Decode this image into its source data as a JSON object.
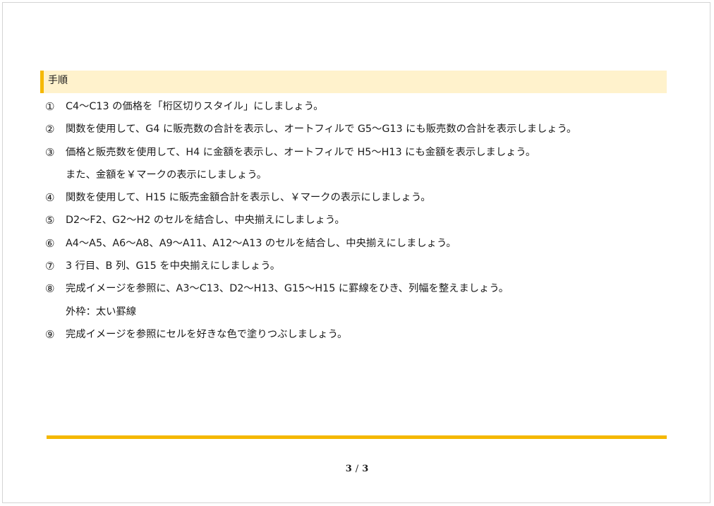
{
  "section": {
    "title": "手順"
  },
  "steps": [
    {
      "num": "①",
      "text": "C4～C13 の価格を「桁区切りスタイル」にしましょう。"
    },
    {
      "num": "②",
      "text": "関数を使用して、G4 に販売数の合計を表示し、オートフィルで G5～G13 にも販売数の合計を表示しましょう。"
    },
    {
      "num": "③",
      "text": "価格と販売数を使用して、H4 に金額を表示し、オートフィルで H5～H13 にも金額を表示しましょう。"
    },
    {
      "num": "",
      "text": "また、金額を￥マークの表示にしましょう。"
    },
    {
      "num": "④",
      "text": "関数を使用して、H15 に販売金額合計を表示し、￥マークの表示にしましょう。"
    },
    {
      "num": "⑤",
      "text": "D2～F2、G2～H2 のセルを結合し、中央揃えにしましょう。"
    },
    {
      "num": "⑥",
      "text": "A4～A5、A6～A8、A9～A11、A12～A13 のセルを結合し、中央揃えにしましょう。"
    },
    {
      "num": "⑦",
      "text": "3 行目、B 列、G15 を中央揃えにしましょう。"
    },
    {
      "num": "⑧",
      "text": "完成イメージを参照に、A3～C13、D2～H13、G15～H15 に罫線をひき、列幅を整えましょう。"
    },
    {
      "num": "",
      "text": "外枠：太い罫線"
    },
    {
      "num": "⑨",
      "text": "完成イメージを参照にセルを好きな色で塗りつぶしましょう。"
    }
  ],
  "footer": {
    "current_page": "3",
    "separator": "/",
    "total_pages": "3"
  },
  "colors": {
    "accent": "#f5b800",
    "header_background": "#fff2cc"
  }
}
